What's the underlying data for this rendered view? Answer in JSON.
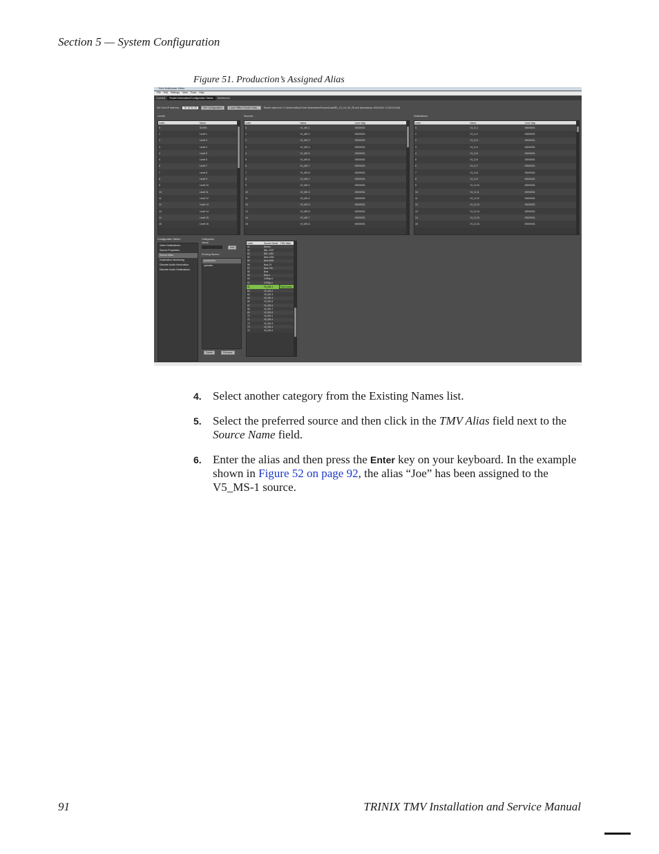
{
  "header": {
    "text": "Section 5  —  System Configuration"
  },
  "figure": {
    "caption": "Figure 51.  Production’s Assigned Alias",
    "app": {
      "title": "Trinix Multiviewer Editor",
      "menu": [
        "File",
        "Edit",
        "Settings",
        "View",
        "Tools",
        "Help"
      ],
      "tabs": [
        "Connect",
        "Router Information/Configuration Tables",
        "Workbench"
      ],
      "ip_label": "MV Host IP Address:",
      "ip_value": "10.16.94.25",
      "set_config_label": "Set Configuration",
      "load_offline_label": "Load Offline Router Data...",
      "router_info": "Router data from 'C:\\Users\\Valley\\Trinix Multiviewer\\RouterData\\RD_10_16_94_25.xml' (timestamp: 8/31/2011 10:26:24 AM)",
      "levels": {
        "title": "Levels:",
        "columns": [
          "Index",
          "Name"
        ],
        "rows": [
          [
            "0",
            "SD/HD"
          ],
          [
            "1",
            "Level 1"
          ],
          [
            "2",
            "Level 3"
          ],
          [
            "3",
            "Level 4"
          ],
          [
            "4",
            "Level 5"
          ],
          [
            "5",
            "Level 6"
          ],
          [
            "6",
            "Level 7"
          ],
          [
            "7",
            "Level 8"
          ],
          [
            "8",
            "Level 9"
          ],
          [
            "9",
            "Level 10"
          ],
          [
            "10",
            "Level 11"
          ],
          [
            "11",
            "Level 12"
          ],
          [
            "12",
            "Level 13"
          ],
          [
            "13",
            "Level 14"
          ],
          [
            "14",
            "Level 15"
          ],
          [
            "15",
            "Level 16"
          ]
        ]
      },
      "sources": {
        "title": "Sources:",
        "columns": [
          "Index",
          "Name",
          "Level Map"
        ],
        "rows": [
          [
            "0",
            "V1_MS-1",
            "00000001"
          ],
          [
            "1",
            "V1_MS-2",
            "00000001"
          ],
          [
            "2",
            "V1_MS-3",
            "00000001"
          ],
          [
            "3",
            "V1_MS-4",
            "00000001"
          ],
          [
            "4",
            "V1_MS-5",
            "00000001"
          ],
          [
            "5",
            "V1_MS-6",
            "00000001"
          ],
          [
            "6",
            "V1_MS-7",
            "00000001"
          ],
          [
            "7",
            "V1_MS-8",
            "00000001"
          ],
          [
            "8",
            "V2_MS-1",
            "00000001"
          ],
          [
            "9",
            "V2_MS-2",
            "00000001"
          ],
          [
            "10",
            "V2_MS-3",
            "00000001"
          ],
          [
            "11",
            "V2_MS-4",
            "00000001"
          ],
          [
            "12",
            "V2_MS-5",
            "00000001"
          ],
          [
            "13",
            "V2_MS-6",
            "00000001"
          ],
          [
            "14",
            "V2_MS-7",
            "00000001"
          ],
          [
            "15",
            "V2_MS-8",
            "00000001"
          ]
        ]
      },
      "destinations": {
        "title": "Destinations:",
        "columns": [
          "Index",
          "Name",
          "Level Map"
        ],
        "rows": [
          [
            "0",
            "V1_D-1",
            "00000001"
          ],
          [
            "1",
            "V1_D-2",
            "00000001"
          ],
          [
            "2",
            "V1_D-3",
            "00000001"
          ],
          [
            "3",
            "V1_D-4",
            "00000001"
          ],
          [
            "4",
            "V1_D-5",
            "00000001"
          ],
          [
            "5",
            "V1_D-6",
            "00000001"
          ],
          [
            "6",
            "V1_D-7",
            "00000001"
          ],
          [
            "7",
            "V1_D-8",
            "00000001"
          ],
          [
            "8",
            "V1_D-9",
            "00000001"
          ],
          [
            "9",
            "V1_D-10",
            "00000001"
          ],
          [
            "10",
            "V1_D-11",
            "00000001"
          ],
          [
            "11",
            "V1_D-12",
            "00000001"
          ],
          [
            "12",
            "V1_D-13",
            "00000001"
          ],
          [
            "13",
            "V1_D-14",
            "00000001"
          ],
          [
            "14",
            "V1_D-15",
            "00000001"
          ],
          [
            "15",
            "V1_D-16",
            "00000001"
          ]
        ]
      },
      "config_tables": {
        "title": "Configuration Tables:",
        "items": [
          "Video Destinations",
          "Source Properties",
          "Source Alias",
          "Destination Monitoring",
          "Discrete Audio Information",
          "Discrete Audio Destinations"
        ],
        "selected": 2
      },
      "categories": {
        "title": "Categories:",
        "name_label": "Name:",
        "add_label": "Add",
        "existing_label": "Existing Names:",
        "names": [
          "production",
          "operator"
        ],
        "delete_label": "Delete",
        "rename_label": "Rename"
      },
      "alias_table": {
        "columns": [
          "Index",
          "Source Name",
          "TMV Alias"
        ],
        "rows": [
          [
            "51",
            "Netcue",
            ""
          ],
          [
            "52",
            "BBL-720P",
            ""
          ],
          [
            "53",
            "BBL-1080",
            ""
          ],
          [
            "54",
            "Bars-1080",
            ""
          ],
          [
            "55",
            "Bars1080i",
            ""
          ],
          [
            "56",
            "Bars-76",
            ""
          ],
          [
            "57",
            "Bars-75a",
            ""
          ],
          [
            "58",
            "Bars",
            ""
          ],
          [
            "59",
            "Bars-e",
            ""
          ],
          [
            "60",
            "1035sp-e",
            ""
          ],
          [
            "61",
            "1035sp-e",
            ""
          ],
          [
            "62",
            "V5_MS-1",
            "Paul Gooey"
          ],
          [
            "63",
            "V5_MS-2",
            ""
          ],
          [
            "64",
            "V5_MS-3",
            ""
          ],
          [
            "65",
            "V5_MS-4",
            ""
          ],
          [
            "66",
            "V5_MS-5",
            ""
          ],
          [
            "67",
            "V5_MS-6",
            ""
          ],
          [
            "68",
            "V5_MS-7",
            ""
          ],
          [
            "69",
            "V5_MS-8",
            ""
          ],
          [
            "70",
            "V6_MS-1",
            ""
          ],
          [
            "71",
            "V6_MS-2",
            ""
          ],
          [
            "72",
            "V6_MS-3",
            ""
          ],
          [
            "73",
            "V6_MS-4",
            ""
          ],
          [
            "74",
            "V6_MS-5",
            ""
          ]
        ],
        "highlight_row": 11
      }
    }
  },
  "steps": [
    {
      "num": "4.",
      "parts": [
        {
          "t": "Select another category from the Existing Names list."
        }
      ]
    },
    {
      "num": "5.",
      "parts": [
        {
          "t": "Select the preferred source and then click in the "
        },
        {
          "t": "TMV Alias",
          "s": "i"
        },
        {
          "t": " field next to the "
        },
        {
          "t": "Source Name",
          "s": "i"
        },
        {
          "t": " field."
        }
      ]
    },
    {
      "num": "6.",
      "parts": [
        {
          "t": "Enter the alias and then press the "
        },
        {
          "t": "Enter",
          "s": "key"
        },
        {
          "t": " key on your keyboard. In the example shown in "
        },
        {
          "t": "Figure 52 on page 92",
          "s": "link"
        },
        {
          "t": ", the alias “Joe” has been assigned to the V5_MS-1 source."
        }
      ]
    }
  ],
  "footer": {
    "page": "91",
    "title": "TRINIX TMV Installation and Service Manual"
  }
}
